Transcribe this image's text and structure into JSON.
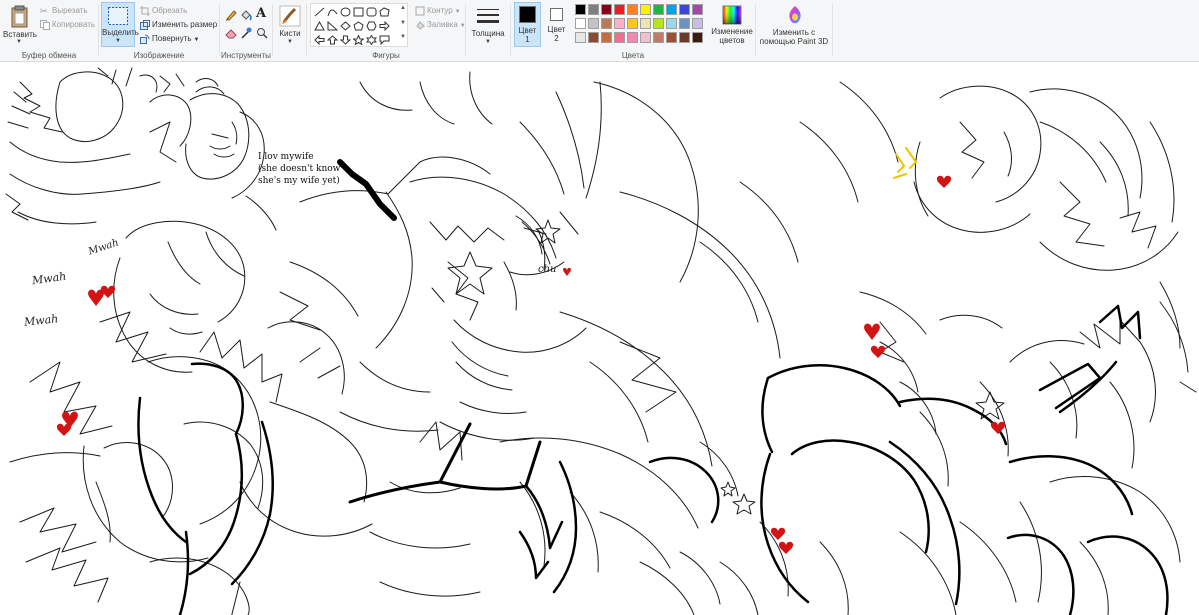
{
  "ribbon": {
    "clipboard": {
      "paste_label": "Вставить",
      "cut_label": "Вырезать",
      "copy_label": "Копировать",
      "group_label": "Буфер обмена"
    },
    "image": {
      "select_label": "Выделить",
      "crop_label": "Обрезать",
      "resize_label": "Изменить размер",
      "rotate_label": "Повернуть",
      "group_label": "Изображение"
    },
    "tools": {
      "group_label": "Инструменты",
      "text_tool_glyph": "A"
    },
    "brushes": {
      "label": "Кисти"
    },
    "shapes": {
      "outline_label": "Контур",
      "fill_label": "Заливка",
      "group_label": "Фигуры"
    },
    "size": {
      "label": "Толщина"
    },
    "colors": {
      "color1_label": "Цвет",
      "color1_index": "1",
      "color2_label": "Цвет",
      "color2_index": "2",
      "edit_colors_label_1": "Изменение",
      "edit_colors_label_2": "цветов",
      "group_label": "Цвета",
      "color1_value": "#000000",
      "color2_value": "#ffffff",
      "palette_row1": [
        "#000000",
        "#7f7f7f",
        "#880015",
        "#ed1c24",
        "#ff7f27",
        "#fff200",
        "#22b14c",
        "#00a2e8",
        "#3f48cc",
        "#a349a4"
      ],
      "palette_row2": [
        "#ffffff",
        "#c3c3c3",
        "#b97a57",
        "#ffaec9",
        "#ffc90e",
        "#efe4b0",
        "#b5e61d",
        "#99d9ea",
        "#7092be",
        "#c8bfe7"
      ],
      "palette_row3": [
        "#e8e8e8",
        "#8c4a32",
        "#c46d42",
        "#f56a8f",
        "#f08ab0",
        "#f0c0d0",
        "#c07a6a",
        "#a05030",
        "#6a3a2a",
        "#3a1a12"
      ]
    },
    "paint3d": {
      "label_1": "Изменить с",
      "label_2": "помощью Paint 3D"
    }
  },
  "canvas": {
    "note_text": "I lov mywife\n(she doesn't know\nshe's my wife yet)",
    "scribble_1": "Mwah",
    "scribble_2": "Mwah",
    "scribble_3": "Mwah",
    "scribble_4": "chu"
  },
  "accent": "#cce4f7"
}
